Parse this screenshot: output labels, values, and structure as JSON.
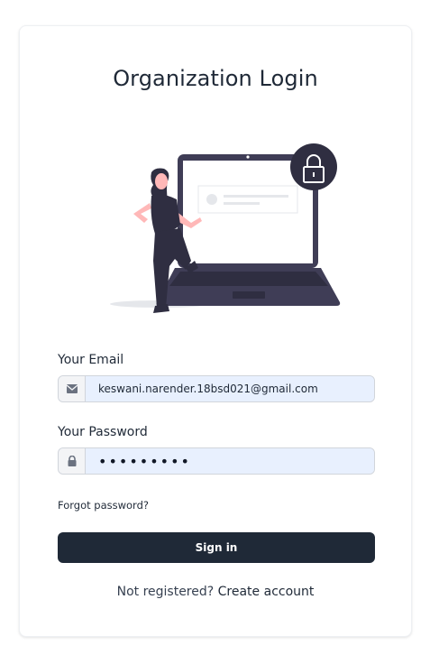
{
  "login": {
    "title": "Organization Login",
    "email_label": "Your Email",
    "email_value": "keswani.narender.18bsd021@gmail.com",
    "password_label": "Your Password",
    "password_value": "•••••••••",
    "forgot_link": "Forgot password?",
    "signin_button": "Sign in",
    "not_registered_text": "Not registered?",
    "create_account_link": "Create account"
  },
  "icons": {
    "email": "envelope-icon",
    "password": "lock-icon",
    "illustration_lock": "padlock-icon"
  },
  "colors": {
    "primary": "#1f2937",
    "input_autofill_bg": "#e8f0fe",
    "addon_bg": "#f3f4f6"
  }
}
